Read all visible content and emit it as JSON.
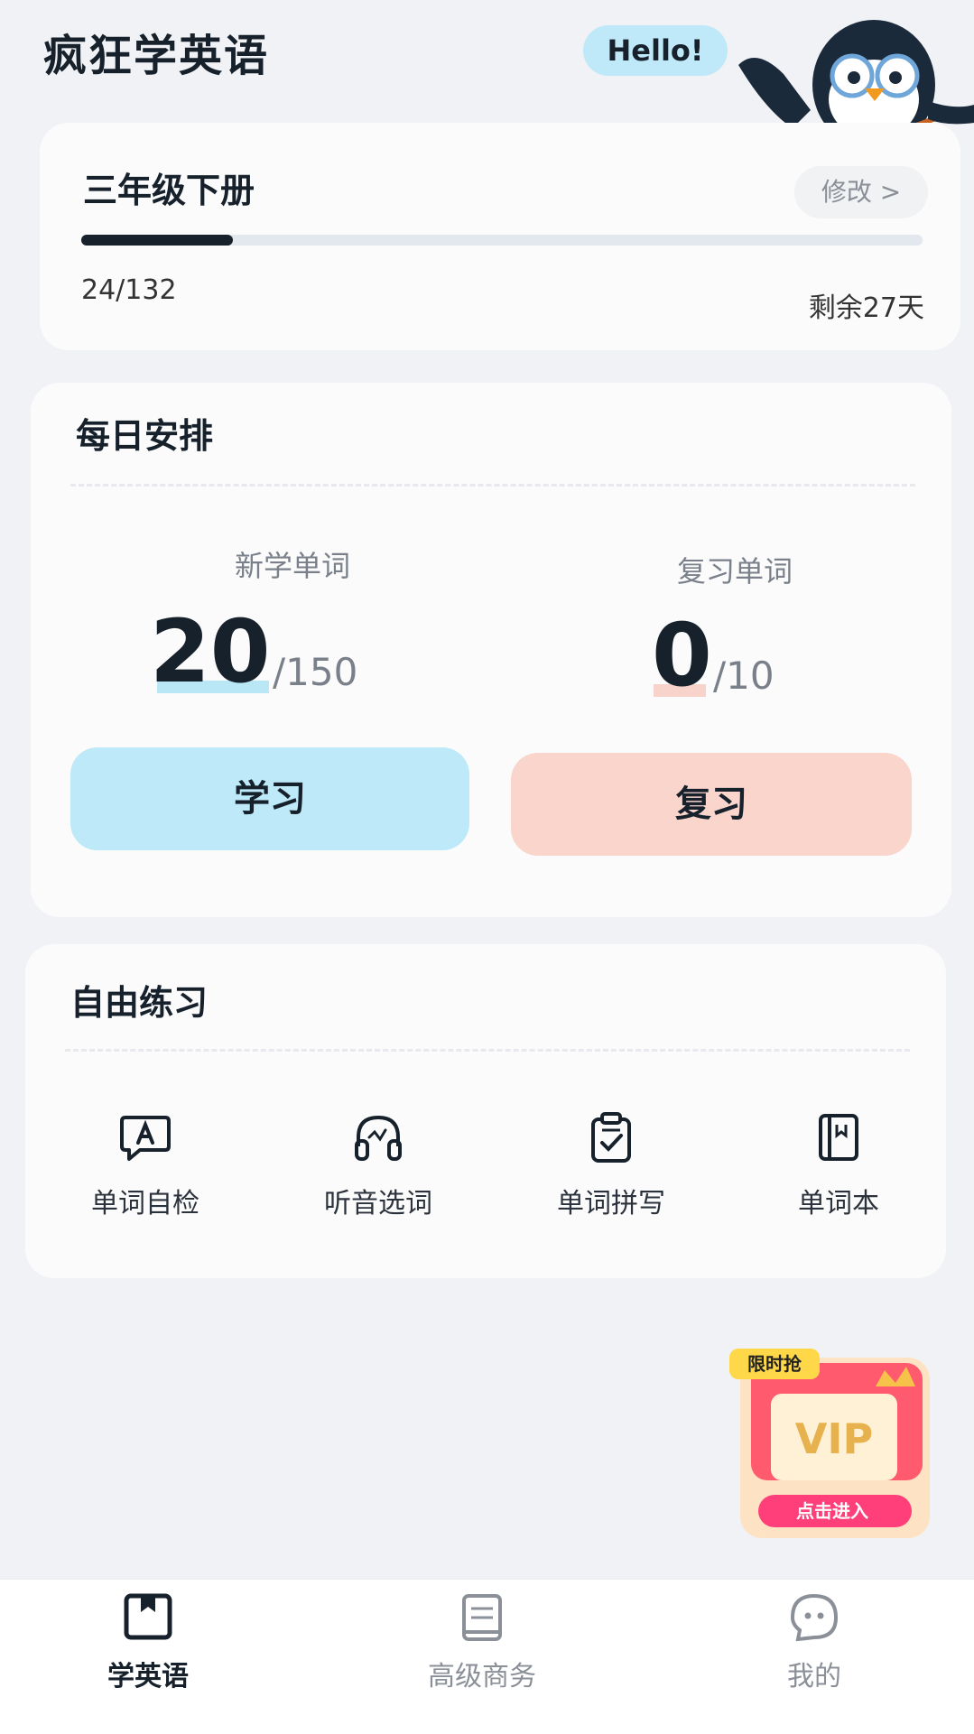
{
  "header": {
    "title": "疯狂学英语",
    "greeting": "Hello!"
  },
  "progress": {
    "book": "三年级下册",
    "edit_label": "修改 >",
    "done": 24,
    "total": 132,
    "count_text": "24/132",
    "fraction": 0.18,
    "remaining_text": "剩余27天"
  },
  "daily": {
    "title": "每日安排",
    "new_words": {
      "label": "新学单词",
      "value": "20",
      "total": "/150",
      "accent": "#b9e7f6"
    },
    "review_words": {
      "label": "复习单词",
      "value": "0",
      "total": "/10",
      "accent": "#f8d3cc"
    },
    "study_button": "学习",
    "review_button": "复习"
  },
  "practice": {
    "title": "自由练习",
    "items": [
      {
        "label": "单词自检",
        "icon": "speech-bubble-a-icon"
      },
      {
        "label": "听音选词",
        "icon": "headphones-icon"
      },
      {
        "label": "单词拼写",
        "icon": "clipboard-check-icon"
      },
      {
        "label": "单词本",
        "icon": "notebook-icon"
      }
    ]
  },
  "promo": {
    "badge": "限时抢",
    "brand": "VIP",
    "cta": "点击进入"
  },
  "tabs": [
    {
      "label": "学英语",
      "icon": "book-bookmark-icon",
      "active": true
    },
    {
      "label": "高级商务",
      "icon": "textbook-icon",
      "active": false
    },
    {
      "label": "我的",
      "icon": "chat-face-icon",
      "active": false
    }
  ],
  "colors": {
    "accent_dark": "#16212c",
    "study_button": "#bde9f8",
    "review_button": "#f9d5cc",
    "background": "#f1f2f5"
  }
}
